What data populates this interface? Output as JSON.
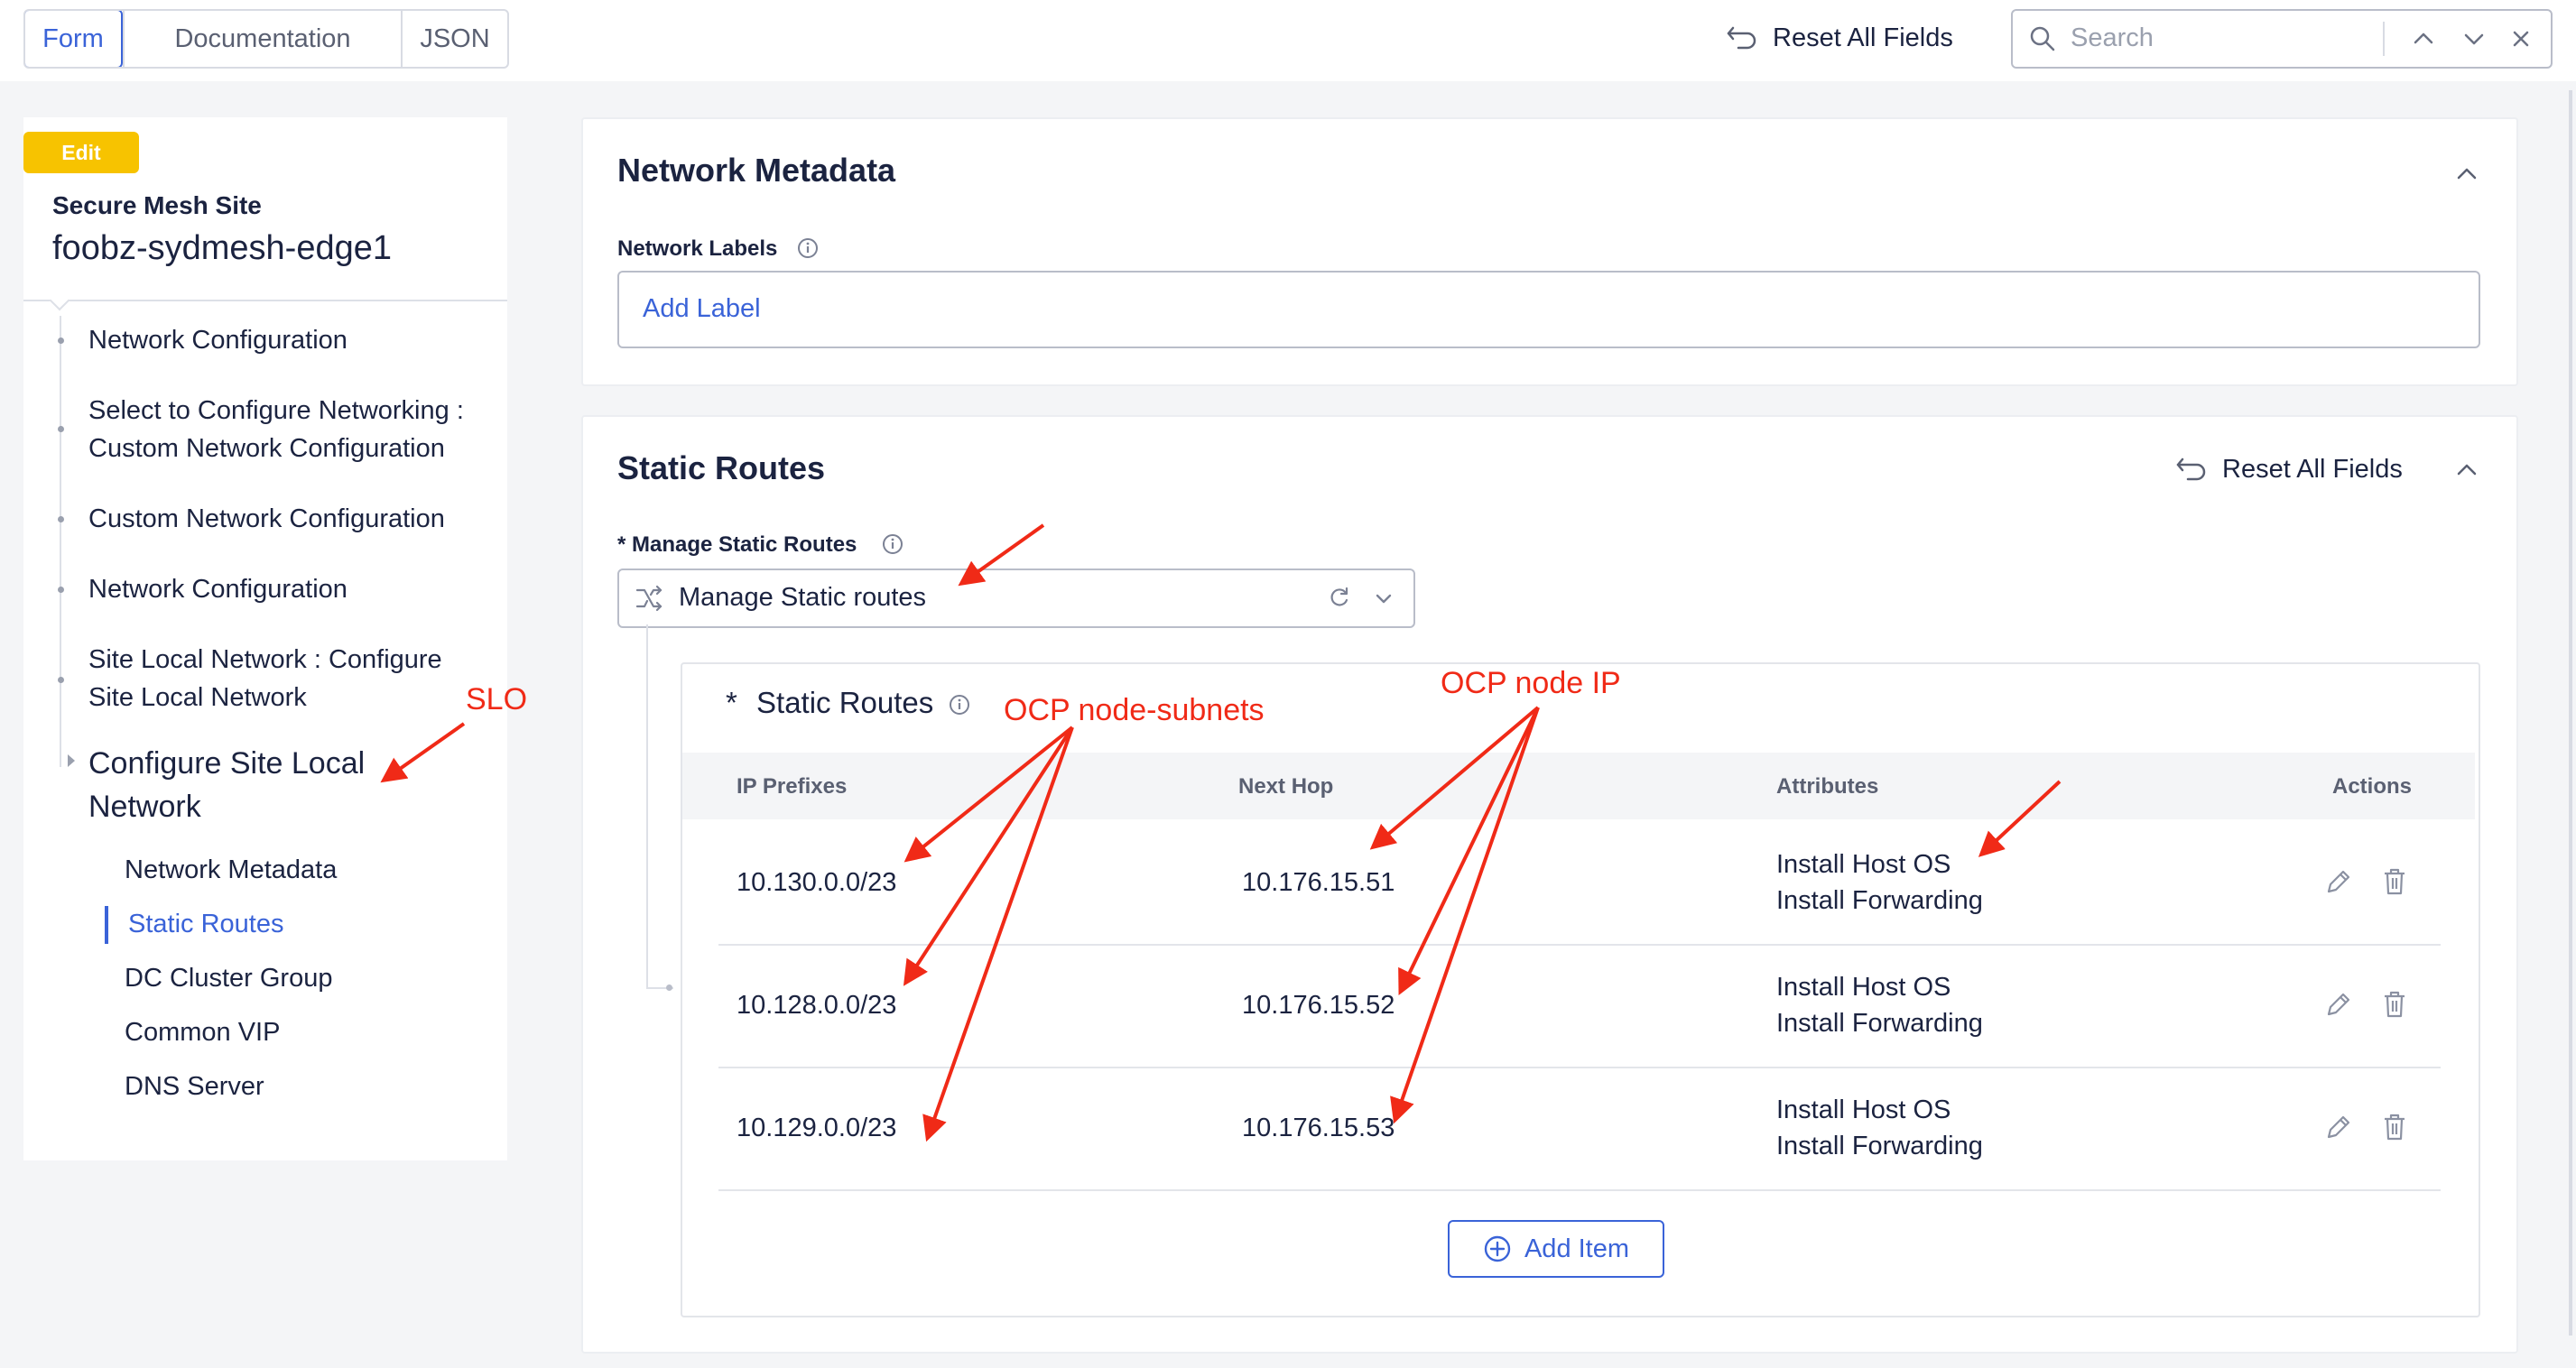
{
  "tabs": [
    {
      "label": "Form",
      "active": true
    },
    {
      "label": "Documentation",
      "active": false
    },
    {
      "label": "JSON",
      "active": false
    }
  ],
  "toolbar": {
    "reset_label": "Reset All Fields",
    "search_placeholder": "Search"
  },
  "sidebar": {
    "badge": "Edit",
    "object_kind": "Secure Mesh Site",
    "object_name": "foobz-sydmesh-edge1",
    "nav_items": [
      "Network Configuration",
      "Select to Configure Networking : Custom Network Configuration",
      "Custom Network Configuration",
      "Network Configuration",
      "Site Local Network : Configure Site Local Network"
    ],
    "current_section": "Configure Site Local Network",
    "sub_items": [
      {
        "label": "Network Metadata",
        "active": false
      },
      {
        "label": "Static Routes",
        "active": true
      },
      {
        "label": "DC Cluster Group",
        "active": false
      },
      {
        "label": "Common VIP",
        "active": false
      },
      {
        "label": "DNS Server",
        "active": false
      }
    ]
  },
  "network_metadata": {
    "title": "Network Metadata",
    "labels_field": "Network Labels",
    "labels_placeholder": "Add Label"
  },
  "static_routes": {
    "title": "Static Routes",
    "reset_label": "Reset All Fields",
    "manage_label": "* Manage Static Routes",
    "manage_value": "Manage Static routes",
    "subsection_required": "*",
    "subsection_title": "Static Routes",
    "columns": [
      "IP Prefixes",
      "Next Hop",
      "Attributes",
      "Actions"
    ],
    "rows": [
      {
        "prefix": "10.130.0.0/23",
        "next_hop": "10.176.15.51",
        "attr1": "Install Host OS",
        "attr2": "Install Forwarding"
      },
      {
        "prefix": "10.128.0.0/23",
        "next_hop": "10.176.15.52",
        "attr1": "Install Host OS",
        "attr2": "Install Forwarding"
      },
      {
        "prefix": "10.129.0.0/23",
        "next_hop": "10.176.15.53",
        "attr1": "Install Host OS",
        "attr2": "Install Forwarding"
      }
    ],
    "add_item_label": "Add Item"
  },
  "annotations": {
    "slo": "SLO",
    "node_subnets": "OCP node-subnets",
    "node_ip": "OCP node IP"
  },
  "colors": {
    "accent": "#3a63d8",
    "badge": "#f7c300",
    "annotation": "#f02a17"
  }
}
